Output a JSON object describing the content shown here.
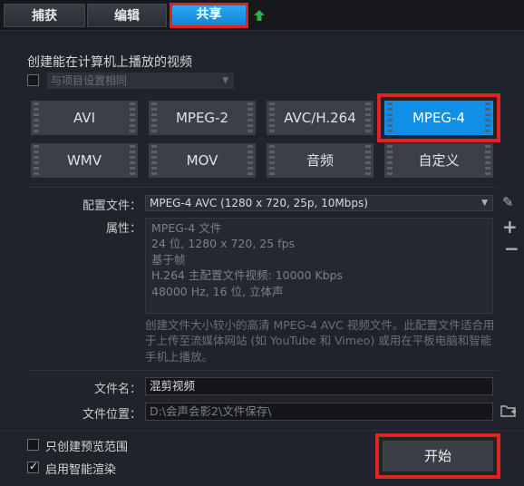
{
  "tabs": {
    "capture": "捕获",
    "edit": "编辑",
    "share": "共享"
  },
  "section_title": "创建能在计算机上播放的视频",
  "same_settings": {
    "label": "与项目设置相同",
    "checked": false
  },
  "formats": [
    "AVI",
    "MPEG-2",
    "AVC/H.264",
    "MPEG-4",
    "WMV",
    "MOV",
    "音频",
    "自定义"
  ],
  "selected_format": "MPEG-4",
  "profile": {
    "label": "配置文件：",
    "value": "MPEG-4 AVC (1280 x 720, 25p, 10Mbps)"
  },
  "properties": {
    "label": "属性：",
    "lines": [
      "MPEG-4 文件",
      "24 位, 1280 x 720, 25 fps",
      "基于帧",
      "H.264 主配置文件视频: 10000 Kbps",
      "48000 Hz, 16 位, 立体声"
    ]
  },
  "description": "创建文件大小较小的高清 MPEG-4 AVC 视频文件。此配置文件适合用于上传至流媒体网站 (如 YouTube 和 Vimeo) 或用在平板电脑和智能手机上播放。",
  "file_name": {
    "label": "文件名：",
    "value": "混剪视频"
  },
  "file_location": {
    "label": "文件位置：",
    "value": "D:\\会声会影2\\文件保存\\"
  },
  "options": [
    {
      "label": "只创建预览范围",
      "checked": false
    },
    {
      "label": "启用智能渲染",
      "checked": true
    }
  ],
  "start_button": "开始",
  "colors": {
    "accent": "#0f8fe8",
    "highlight": "#e0231e",
    "upload_arrow": "#2bb24c"
  }
}
